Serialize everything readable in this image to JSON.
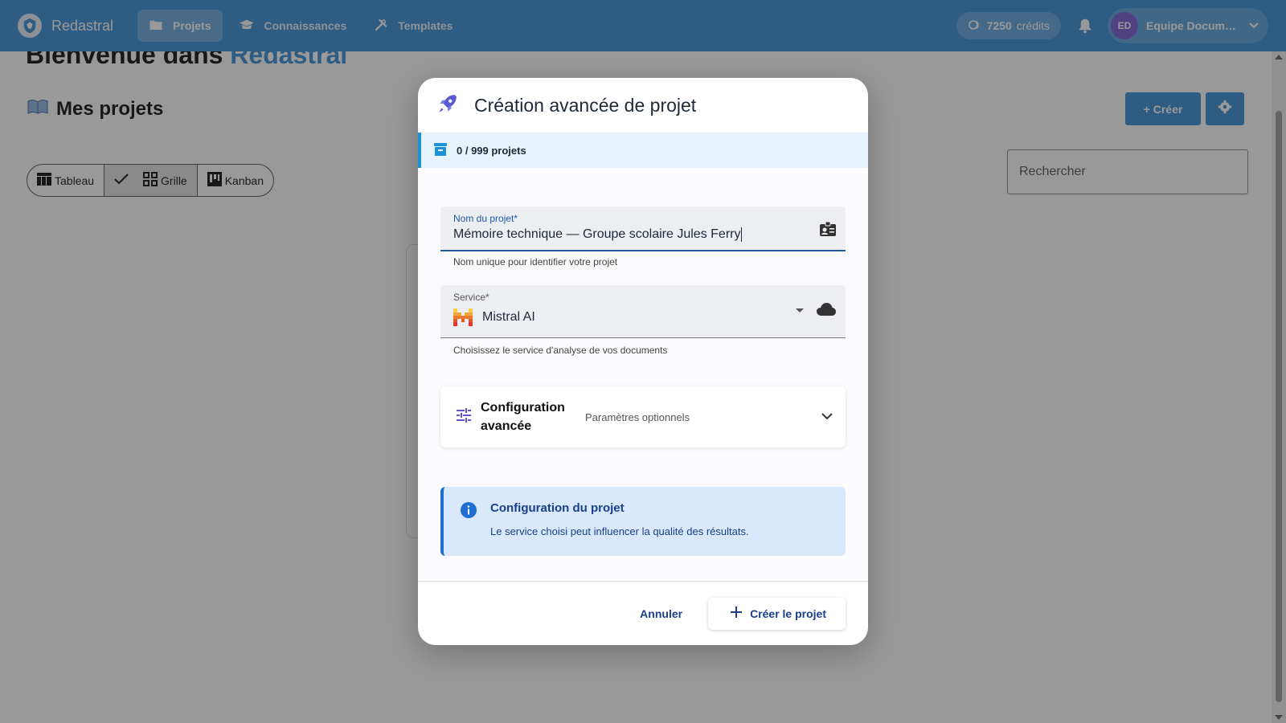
{
  "colors": {
    "primary": "#3a8fd6",
    "dialog_accent": "#1e5aa8",
    "info_bg": "#d9e9fb",
    "quota_bg": "#e6f3fc"
  },
  "topbar": {
    "brand": "Redastral",
    "nav": [
      {
        "label": "Projets",
        "icon": "folder-icon",
        "active": true
      },
      {
        "label": "Connaissances",
        "icon": "graduation-cap-icon"
      },
      {
        "label": "Templates",
        "icon": "tools-icon"
      }
    ],
    "credits": {
      "value": "7250",
      "unit": "crédits"
    },
    "user": {
      "initials": "ED",
      "name": "Equipe Documen..."
    }
  },
  "page": {
    "welcome_prefix": "Bienvenue dans",
    "welcome_brand": "Redastral",
    "section_title": "Mes projets",
    "create_button": "+ Créer",
    "views": [
      {
        "label": "Tableau",
        "icon": "table-icon"
      },
      {
        "label": "Grille",
        "icon": "grid-icon",
        "selected": true
      },
      {
        "label": "Kanban",
        "icon": "kanban-icon"
      }
    ],
    "search_placeholder": "Rechercher"
  },
  "dialog": {
    "title": "Création avancée de projet",
    "quota": "0 / 999 projets",
    "name_field": {
      "label": "Nom du projet*",
      "value": "Mémoire technique — Groupe scolaire Jules Ferry",
      "hint": "Nom unique pour identifier votre projet"
    },
    "service_field": {
      "label": "Service*",
      "value": "Mistral AI",
      "hint": "Choisissez le service d'analyse de vos documents"
    },
    "advanced": {
      "title": "Configuration avancée",
      "subtitle": "Paramètres optionnels"
    },
    "info": {
      "title": "Configuration du projet",
      "text": "Le service choisi peut influencer la qualité des résultats."
    },
    "cancel": "Annuler",
    "submit": "Créer le projet"
  }
}
